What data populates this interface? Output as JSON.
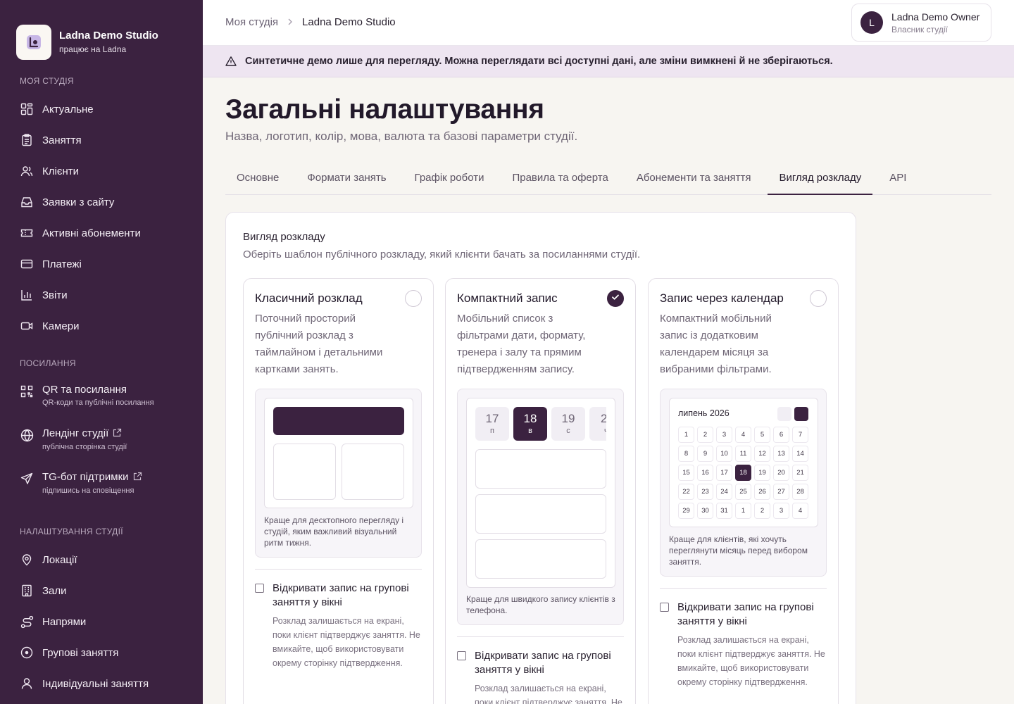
{
  "brand": {
    "name": "Ladna Demo Studio",
    "sub": "працює на Ladna"
  },
  "sidebar": {
    "sections": [
      {
        "label": "МОЯ СТУДІЯ",
        "items": [
          {
            "label": "Актуальне",
            "icon": "dashboard-icon"
          },
          {
            "label": "Заняття",
            "icon": "clipboard-icon"
          },
          {
            "label": "Клієнти",
            "icon": "users-icon"
          },
          {
            "label": "Заявки з сайту",
            "icon": "inbox-icon"
          },
          {
            "label": "Активні абонементи",
            "icon": "ticket-icon"
          },
          {
            "label": "Платежі",
            "icon": "card-icon"
          },
          {
            "label": "Звіти",
            "icon": "bar-chart-icon"
          },
          {
            "label": "Камери",
            "icon": "video-icon"
          }
        ]
      },
      {
        "label": "ПОСИЛАННЯ",
        "items": [
          {
            "label": "QR та посилання",
            "sub": "QR-коди та публічні посилання",
            "icon": "qr-icon",
            "external": false
          },
          {
            "label": "Лендінг студії",
            "sub": "публічна сторінка студії",
            "icon": "globe-icon",
            "external": true
          },
          {
            "label": "TG-бот підтримки",
            "sub": "підпишись на сповіщення",
            "icon": "send-icon",
            "external": true
          }
        ]
      },
      {
        "label": "НАЛАШТУВАННЯ СТУДІЇ",
        "items": [
          {
            "label": "Локації",
            "icon": "map-pin-icon"
          },
          {
            "label": "Зали",
            "icon": "building-icon"
          },
          {
            "label": "Напрями",
            "icon": "route-icon"
          },
          {
            "label": "Групові заняття",
            "icon": "circle-dot-icon"
          },
          {
            "label": "Індивідуальні заняття",
            "icon": "user-icon"
          }
        ]
      }
    ]
  },
  "header": {
    "breadcrumb": [
      "Моя студія",
      "Ladna Demo Studio"
    ],
    "user": {
      "initial": "L",
      "name": "Ladna Demo Owner",
      "role": "Власник студії"
    }
  },
  "banner": {
    "text": "Синтетичне демо лише для перегляду. Можна переглядати всі доступні дані, але зміни вимкнені й не зберігаються.",
    "icon": "warning-icon"
  },
  "page": {
    "title": "Загальні налаштування",
    "subtitle": "Назва, логотип, колір, мова, валюта та базові параметри студії.",
    "tabs": [
      "Основне",
      "Формати занять",
      "Графік роботи",
      "Правила та оферта",
      "Абонементи та заняття",
      "Вигляд розкладу",
      "API"
    ],
    "active_tab": 5
  },
  "schedule_view": {
    "title": "Вигляд розкладу",
    "subtitle": "Оберіть шаблон публічного розкладу, який клієнти бачать за посиланнями студії.",
    "options": [
      {
        "title": "Класичний розклад",
        "desc": "Поточний просторий публічний розклад з таймлайном і детальними картками занять.",
        "note": "Краще для десктопного перегляду і студій, яким важливий візуальний ритм тижня.",
        "selected": false,
        "checkbox_label": "Відкривати запис на групові заняття у вікні",
        "checkbox_hint": "Розклад залишається на екрані, поки клієнт підтверджує заняття. Не вмикайте, щоб використовувати окрему сторінку підтвердження."
      },
      {
        "title": "Компактний запис",
        "desc": "Мобільний список з фільтрами дати, формату, тренера і залу та прямим підтвердженням запису.",
        "note": "Краще для швидкого запису клієнтів з телефона.",
        "selected": true,
        "days": [
          {
            "num": "17",
            "label": "п"
          },
          {
            "num": "18",
            "label": "в"
          },
          {
            "num": "19",
            "label": "с"
          },
          {
            "num": "2",
            "label": "ч"
          }
        ],
        "selected_day": 1,
        "checkbox_label": "Відкривати запис на групові заняття у вікні",
        "checkbox_hint": "Розклад залишається на екрані, поки клієнт підтверджує заняття. Не вмикайте, щоб використовувати окрему сторінку підтвердження."
      },
      {
        "title": "Запис через календар",
        "desc": "Компактний мобільний запис із додатковим календарем місяця за вибраними фільтрами.",
        "note": "Краще для клієнтів, які хочуть переглянути місяць перед вибором заняття.",
        "selected": false,
        "month": "липень 2026",
        "calendar": [
          "1",
          "2",
          "3",
          "4",
          "5",
          "6",
          "7",
          "8",
          "9",
          "10",
          "11",
          "12",
          "13",
          "14",
          "15",
          "16",
          "17",
          "18",
          "19",
          "20",
          "21",
          "22",
          "23",
          "24",
          "25",
          "26",
          "27",
          "28",
          "29",
          "30",
          "31",
          "1",
          "2",
          "3",
          "4"
        ],
        "selected_date_index": 17,
        "checkbox_label": "Відкривати запис на групові заняття у вікні",
        "checkbox_hint": "Розклад залишається на екрані, поки клієнт підтверджує заняття. Не вмикайте, щоб використовувати окрему сторінку підтвердження."
      }
    ]
  },
  "colors": {
    "sidebar": "#3b2240",
    "accent": "#3b2240",
    "banner": "#eee5f1"
  }
}
